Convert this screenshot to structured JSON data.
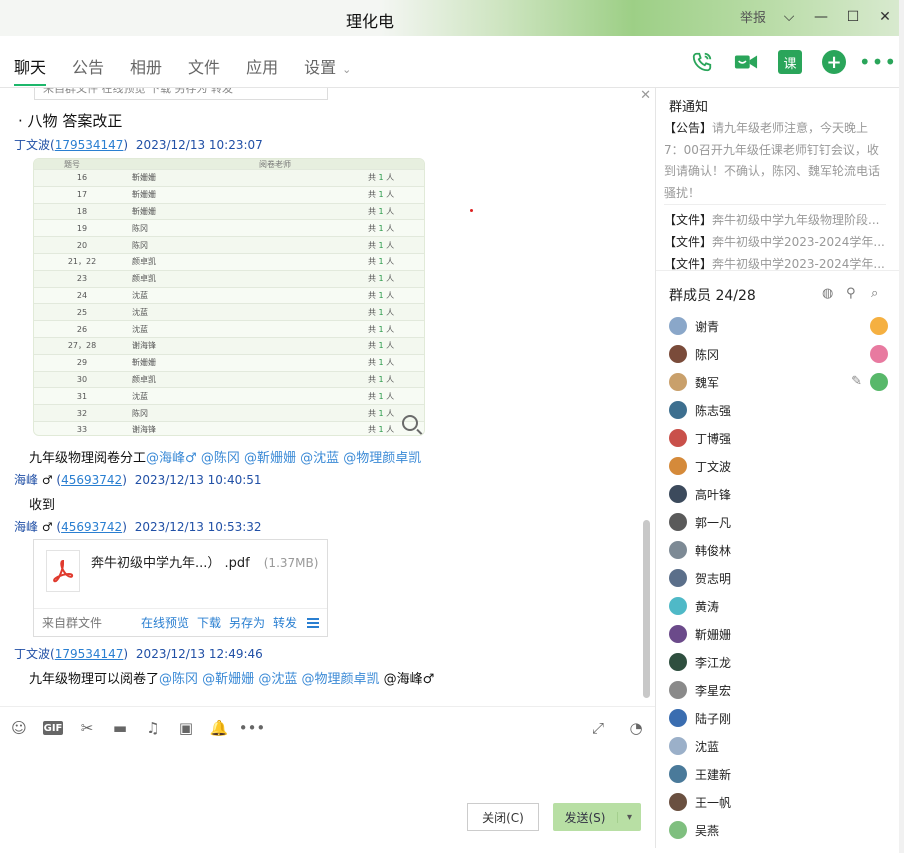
{
  "window": {
    "title": "理化电",
    "report_label": "举报"
  },
  "nav": {
    "tabs": [
      {
        "label": "聊天"
      },
      {
        "label": "公告"
      },
      {
        "label": "相册"
      },
      {
        "label": "文件"
      },
      {
        "label": "应用"
      },
      {
        "label": "设置"
      }
    ],
    "course_label": "课"
  },
  "chat": {
    "top_card_text": "来自群文件    在线预览  下载  另存为  转发",
    "section_title": "八物 答案改正",
    "messages": [
      {
        "sender": "丁文波",
        "qq": "179534147",
        "time": "2023/12/13 10:23:07"
      },
      {
        "sender": "海峰",
        "gender": "♂",
        "qq": "45693742",
        "time": "2023/12/13 10:40:51",
        "text": "收到"
      },
      {
        "sender": "海峰",
        "gender": "♂",
        "qq": "45693742",
        "time": "2023/12/13 10:53:32"
      },
      {
        "sender": "丁文波",
        "qq": "179534147",
        "time": "2023/12/13 12:49:46"
      }
    ],
    "msg1_caption": {
      "prefix": "九年级物理阅卷分工",
      "mentions": [
        "@海峰♂",
        "@陈冈",
        "@靳姗姗",
        "@沈蓝",
        "@物理颜卓凯"
      ]
    },
    "msg4_caption": {
      "prefix": "九年级物理可以阅卷了",
      "mentions": [
        "@陈冈",
        "@靳姗姗",
        "@沈蓝",
        "@物理颜卓凯"
      ],
      "suffix": "@海峰♂"
    },
    "table_image": {
      "header": [
        "题号",
        "阅卷老师"
      ],
      "rows": [
        {
          "no": "16",
          "teacher": "靳姗姗",
          "count": "共 1 人"
        },
        {
          "no": "17",
          "teacher": "靳姗姗",
          "count": "共 1 人"
        },
        {
          "no": "18",
          "teacher": "靳姗姗",
          "count": "共 1 人"
        },
        {
          "no": "19",
          "teacher": "陈冈",
          "count": "共 1 人"
        },
        {
          "no": "20",
          "teacher": "陈冈",
          "count": "共 1 人"
        },
        {
          "no": "21，22",
          "teacher": "颜卓凯",
          "count": "共 1 人"
        },
        {
          "no": "23",
          "teacher": "颜卓凯",
          "count": "共 1 人"
        },
        {
          "no": "24",
          "teacher": "沈蓝",
          "count": "共 1 人"
        },
        {
          "no": "25",
          "teacher": "沈蓝",
          "count": "共 1 人"
        },
        {
          "no": "26",
          "teacher": "沈蓝",
          "count": "共 1 人"
        },
        {
          "no": "27，28",
          "teacher": "谢海锋",
          "count": "共 1 人"
        },
        {
          "no": "29",
          "teacher": "靳姗姗",
          "count": "共 1 人"
        },
        {
          "no": "30",
          "teacher": "颜卓凯",
          "count": "共 1 人"
        },
        {
          "no": "31",
          "teacher": "沈蓝",
          "count": "共 1 人"
        },
        {
          "no": "32",
          "teacher": "陈冈",
          "count": "共 1 人"
        },
        {
          "no": "33",
          "teacher": "谢海锋",
          "count": "共 1 人"
        }
      ]
    },
    "file_card": {
      "name": "奔牛初级中学九年...） .pdf",
      "size": "(1.37MB)",
      "source": "来自群文件",
      "actions": [
        "在线预览",
        "下载",
        "另存为",
        "转发"
      ]
    }
  },
  "composer": {
    "close_label": "关闭(C)",
    "send_label": "发送(S)"
  },
  "side": {
    "notice_title": "群通知",
    "notice_tag": "【公告】",
    "notice_text": "请九年级老师注意，今天晚上7：00召开九年级任课老师钉钉会议，收到请确认！不确认，陈冈、魏军轮流电话骚扰！",
    "docs": [
      {
        "tag": "【文件】",
        "text": "奔牛初级中学九年级物理阶段..."
      },
      {
        "tag": "【文件】",
        "text": "奔牛初级中学2023-2024学年..."
      },
      {
        "tag": "【文件】",
        "text": "奔牛初级中学2023-2024学年..."
      }
    ],
    "members_title": "群成员 24/28",
    "members": [
      {
        "name": "谢青",
        "color": "#8aa7c9",
        "badge": "#f5b041"
      },
      {
        "name": "陈冈",
        "color": "#7a4b3a",
        "badge": "#e87aa0"
      },
      {
        "name": "魏军",
        "color": "#c9a06b",
        "badge": "#58b86a"
      },
      {
        "name": "陈志强",
        "color": "#3d6f8f"
      },
      {
        "name": "丁博强",
        "color": "#c9504a"
      },
      {
        "name": "丁文波",
        "color": "#d58a3a"
      },
      {
        "name": "高叶锋",
        "color": "#3c4a5c"
      },
      {
        "name": "郭一凡",
        "color": "#5a5a5a"
      },
      {
        "name": "韩俊林",
        "color": "#7d8a95"
      },
      {
        "name": "贺志明",
        "color": "#5b6f8a"
      },
      {
        "name": "黄涛",
        "color": "#4fb9c7"
      },
      {
        "name": "靳姗姗",
        "color": "#6b4a8a"
      },
      {
        "name": "李江龙",
        "color": "#2f4f3f"
      },
      {
        "name": "李星宏",
        "color": "#8a8a8a"
      },
      {
        "name": "陆子刚",
        "color": "#3a6db0"
      },
      {
        "name": "沈蓝",
        "color": "#9bb0c9"
      },
      {
        "name": "王建新",
        "color": "#4a7a9a"
      },
      {
        "name": "王一帆",
        "color": "#6a5040"
      },
      {
        "name": "吴燕",
        "color": "#7fbf7f"
      }
    ]
  }
}
